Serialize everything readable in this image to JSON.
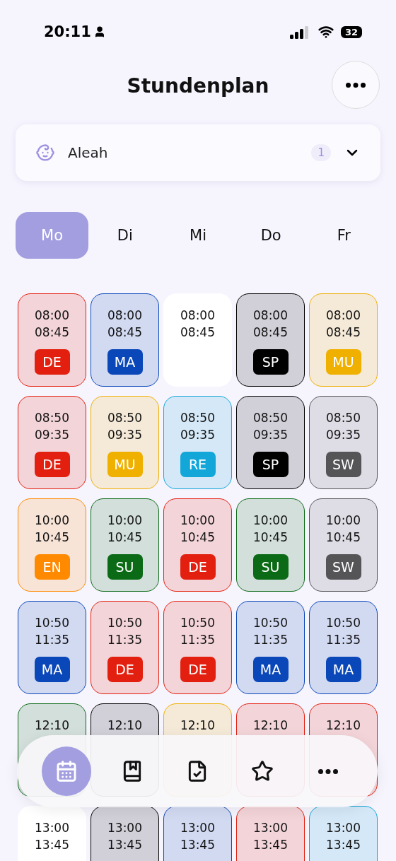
{
  "status_bar": {
    "time": "20:11",
    "battery": "32"
  },
  "header": {
    "title": "Stundenplan"
  },
  "profile": {
    "name": "Aleah",
    "count": "1"
  },
  "days": [
    {
      "label": "Mo",
      "selected": true
    },
    {
      "label": "Di",
      "selected": false
    },
    {
      "label": "Mi",
      "selected": false
    },
    {
      "label": "Do",
      "selected": false
    },
    {
      "label": "Fr",
      "selected": false
    }
  ],
  "rows": [
    {
      "cells": [
        {
          "kind": "lesson",
          "start": "08:00",
          "end": "08:45",
          "subject": "DE",
          "color": "#e3200f"
        },
        {
          "kind": "lesson",
          "start": "08:00",
          "end": "08:45",
          "subject": "MA",
          "color": "#0a47b8"
        },
        {
          "kind": "free",
          "start": "08:00",
          "end": "08:45"
        },
        {
          "kind": "lesson",
          "start": "08:00",
          "end": "08:45",
          "subject": "SP",
          "color": "#000000"
        },
        {
          "kind": "lesson",
          "start": "08:00",
          "end": "08:45",
          "subject": "MU",
          "color": "#efb000"
        }
      ]
    },
    {
      "cells": [
        {
          "kind": "lesson",
          "start": "08:50",
          "end": "09:35",
          "subject": "DE",
          "color": "#e3200f"
        },
        {
          "kind": "lesson",
          "start": "08:50",
          "end": "09:35",
          "subject": "MU",
          "color": "#efb000"
        },
        {
          "kind": "lesson",
          "start": "08:50",
          "end": "09:35",
          "subject": "RE",
          "color": "#13a7d9"
        },
        {
          "kind": "lesson",
          "start": "08:50",
          "end": "09:35",
          "subject": "SP",
          "color": "#000000"
        },
        {
          "kind": "lesson",
          "start": "08:50",
          "end": "09:35",
          "subject": "SW",
          "color": "#555558"
        }
      ]
    },
    {
      "cells": [
        {
          "kind": "lesson",
          "start": "10:00",
          "end": "10:45",
          "subject": "EN",
          "color": "#ff8a00"
        },
        {
          "kind": "lesson",
          "start": "10:00",
          "end": "10:45",
          "subject": "SU",
          "color": "#0b6a16"
        },
        {
          "kind": "lesson",
          "start": "10:00",
          "end": "10:45",
          "subject": "DE",
          "color": "#e3200f"
        },
        {
          "kind": "lesson",
          "start": "10:00",
          "end": "10:45",
          "subject": "SU",
          "color": "#0b6a16"
        },
        {
          "kind": "lesson",
          "start": "10:00",
          "end": "10:45",
          "subject": "SW",
          "color": "#555558"
        }
      ]
    },
    {
      "cells": [
        {
          "kind": "lesson",
          "start": "10:50",
          "end": "11:35",
          "subject": "MA",
          "color": "#0a47b8"
        },
        {
          "kind": "lesson",
          "start": "10:50",
          "end": "11:35",
          "subject": "DE",
          "color": "#e3200f"
        },
        {
          "kind": "lesson",
          "start": "10:50",
          "end": "11:35",
          "subject": "DE",
          "color": "#e3200f"
        },
        {
          "kind": "lesson",
          "start": "10:50",
          "end": "11:35",
          "subject": "MA",
          "color": "#0a47b8"
        },
        {
          "kind": "lesson",
          "start": "10:50",
          "end": "11:35",
          "subject": "MA",
          "color": "#0a47b8"
        }
      ]
    },
    {
      "cells": [
        {
          "kind": "lesson",
          "start": "12:10",
          "color": "#0b6a16"
        },
        {
          "kind": "lesson",
          "start": "12:10",
          "color": "#000000"
        },
        {
          "kind": "lesson",
          "start": "12:10",
          "color": "#efb000"
        },
        {
          "kind": "lesson",
          "start": "12:10",
          "color": "#e3200f"
        },
        {
          "kind": "lesson",
          "start": "12:10",
          "color": "#e3200f"
        }
      ]
    },
    {
      "cells": [
        {
          "kind": "free",
          "start": "13:00",
          "end": "13:45"
        },
        {
          "kind": "lesson",
          "start": "13:00",
          "end": "13:45",
          "color": "#000000"
        },
        {
          "kind": "lesson",
          "start": "13:00",
          "end": "13:45",
          "color": "#0a47b8"
        },
        {
          "kind": "lesson",
          "start": "13:00",
          "end": "13:45",
          "color": "#e3200f"
        },
        {
          "kind": "lesson",
          "start": "13:00",
          "end": "13:45",
          "color": "#13a7d9"
        }
      ]
    }
  ],
  "nav": [
    {
      "kind": "calendar",
      "selected": true
    },
    {
      "kind": "book",
      "selected": false
    },
    {
      "kind": "check-file",
      "selected": false
    },
    {
      "kind": "star",
      "selected": false
    },
    {
      "kind": "more",
      "selected": false
    }
  ]
}
